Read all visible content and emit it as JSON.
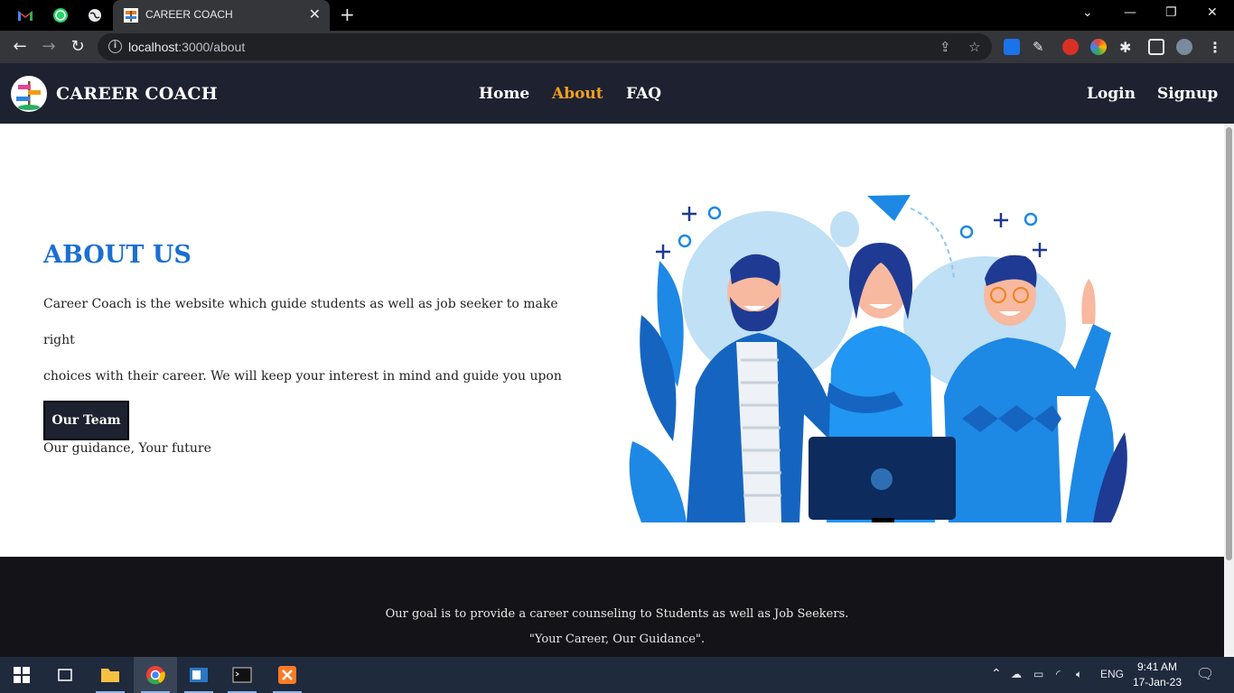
{
  "browser": {
    "tab_title": "CAREER COACH",
    "url_host": "localhost",
    "url_path": ":3000/about",
    "new_tab": "+",
    "close_tab": "✕"
  },
  "site": {
    "brand": "CAREER COACH",
    "nav": [
      "Home",
      "About",
      "FAQ"
    ],
    "auth": [
      "Login",
      "Signup"
    ],
    "active_color": "#f0a01e"
  },
  "about": {
    "title": "ABOUT US",
    "line1": "Career Coach is the website which guide students as well as job seeker to make right",
    "line2": "choices with their career. We will keep your interest in mind and guide you upon that.",
    "line3": "Our guidance, Your future",
    "button": "Our Team"
  },
  "footer": {
    "line1": "Our goal is to provide a career counseling to Students as well as Job Seekers.",
    "line2": "\"Your Career, Our Guidance\"."
  },
  "taskbar": {
    "lang": "ENG",
    "time": "9:41 AM",
    "date": "17-Jan-23"
  }
}
